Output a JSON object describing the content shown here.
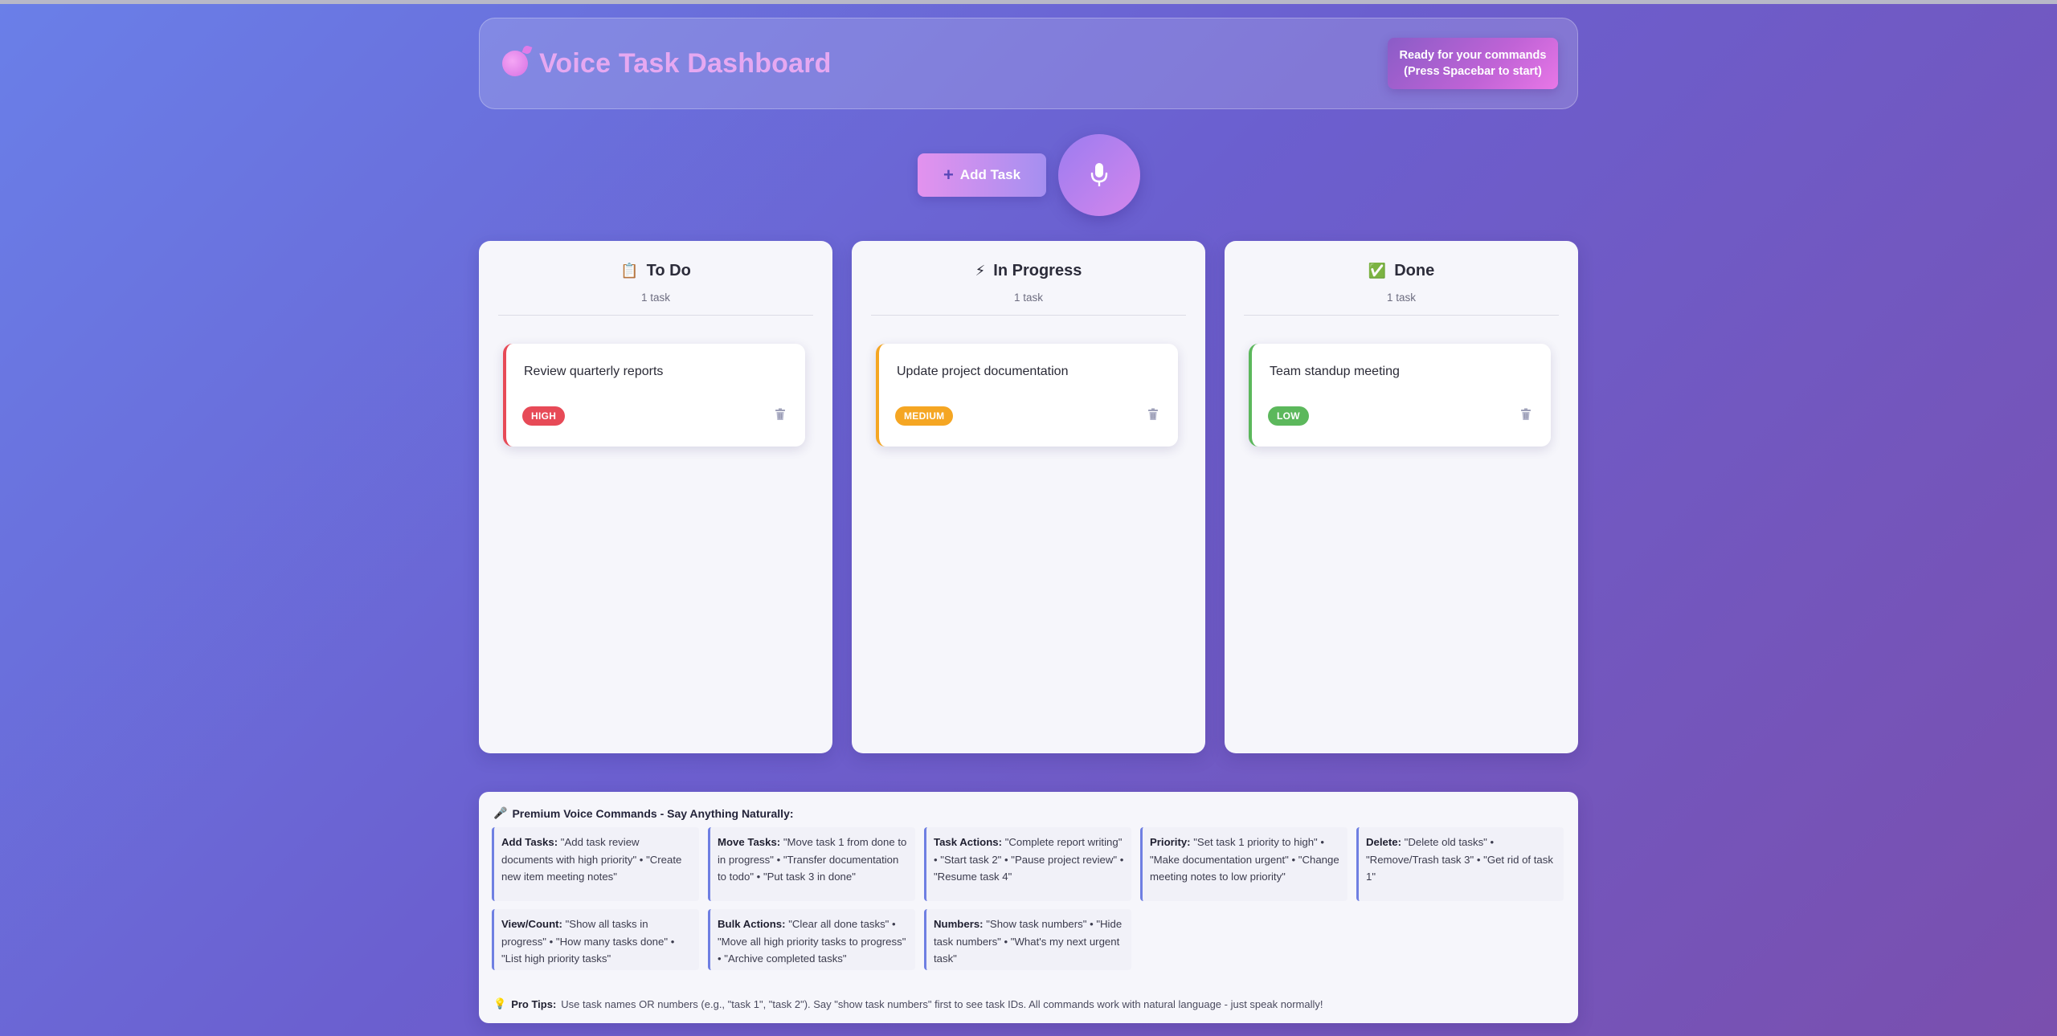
{
  "header": {
    "title": "Voice Task Dashboard",
    "status_line1": "Ready for your commands",
    "status_line2": "(Press Spacebar to start)"
  },
  "controls": {
    "add_task_label": "Add Task",
    "add_icon": "plus-icon",
    "mic_icon": "microphone-icon"
  },
  "columns": [
    {
      "title": "To Do",
      "icon": "clipboard-icon",
      "icon_glyph": "📋",
      "count": "1 task",
      "tasks": [
        {
          "title": "Review quarterly reports",
          "priority": "HIGH",
          "color": "#e74a57"
        }
      ]
    },
    {
      "title": "In Progress",
      "icon": "lightning-icon",
      "icon_glyph": "⚡",
      "count": "1 task",
      "tasks": [
        {
          "title": "Update project documentation",
          "priority": "MEDIUM",
          "color": "#f5a623"
        }
      ]
    },
    {
      "title": "Done",
      "icon": "check-icon",
      "icon_glyph": "✅",
      "count": "1 task",
      "tasks": [
        {
          "title": "Team standup meeting",
          "priority": "LOW",
          "color": "#5cb85c"
        }
      ]
    }
  ],
  "help": {
    "title": "Premium Voice Commands - Say Anything Naturally:",
    "commands": [
      {
        "label": "Add Tasks:",
        "text": "\"Add task review documents with high priority\" • \"Create new item meeting notes\""
      },
      {
        "label": "Move Tasks:",
        "text": "\"Move task 1 from done to in progress\" • \"Transfer documentation to todo\" • \"Put task 3 in done\""
      },
      {
        "label": "Task Actions:",
        "text": "\"Complete report writing\" • \"Start task 2\" • \"Pause project review\" • \"Resume task 4\""
      },
      {
        "label": "Priority:",
        "text": "\"Set task 1 priority to high\" • \"Make documentation urgent\" • \"Change meeting notes to low priority\""
      },
      {
        "label": "Delete:",
        "text": "\"Delete old tasks\" • \"Remove/Trash task 3\" • \"Get rid of task 1\""
      },
      {
        "label": "View/Count:",
        "text": "\"Show all tasks in progress\" • \"How many tasks done\" • \"List high priority tasks\""
      },
      {
        "label": "Bulk Actions:",
        "text": "\"Clear all done tasks\" • \"Move all high priority tasks to progress\" • \"Archive completed tasks\""
      },
      {
        "label": "Numbers:",
        "text": "\"Show task numbers\" • \"Hide task numbers\" • \"What's my next urgent task\""
      }
    ],
    "tips_label": "Pro Tips:",
    "tips_text": "Use task names OR numbers (e.g., \"task 1\", \"task 2\"). Say \"show task numbers\" first to see task IDs. All commands work with natural language - just speak normally!"
  },
  "colors": {
    "high": "#e74a57",
    "medium": "#f5a623",
    "low": "#5cb85c",
    "accent": "#6f7fe2"
  }
}
